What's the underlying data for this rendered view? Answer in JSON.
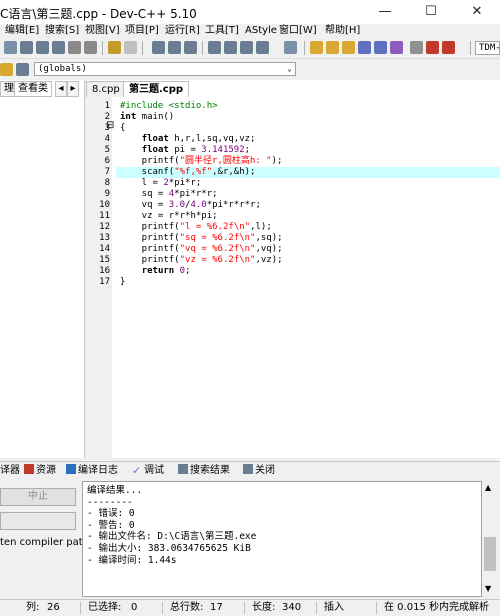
{
  "window": {
    "title": "C语言\\第三题.cpp - Dev-C++ 5.10",
    "minimize": "—",
    "maximize": "☐",
    "close": "✕"
  },
  "menu": [
    "编辑[E]",
    "搜索[S]",
    "视图[V]",
    "项目[P]",
    "运行[R]",
    "工具[T]",
    "AStyle",
    "窗口[W]",
    "帮助[H]"
  ],
  "toolbar": {
    "compiler_combo": "TDM-",
    "scope_combo": "(globals)"
  },
  "left_panel": {
    "tabs": [
      "理",
      "查看类"
    ]
  },
  "editor": {
    "tabs": [
      "8.cpp",
      "第三题.cpp"
    ],
    "active_tab": 1,
    "current_line": 7,
    "fold_marker": "⊟",
    "lines": [
      [
        [
          "pp",
          "#include <stdio.h>"
        ]
      ],
      [
        [
          "kw",
          "int"
        ],
        [
          "t",
          " main()"
        ]
      ],
      [
        [
          "t",
          "{"
        ]
      ],
      [
        [
          "t",
          "    "
        ],
        [
          "kw",
          "float"
        ],
        [
          "t",
          " h,r,l,sq,vq,vz;"
        ]
      ],
      [
        [
          "t",
          "    "
        ],
        [
          "kw",
          "float"
        ],
        [
          "t",
          " pi = "
        ],
        [
          "num",
          "3.141592"
        ],
        [
          "t",
          ";"
        ]
      ],
      [
        [
          "t",
          "    printf("
        ],
        [
          "str",
          "\"圆半径r,圆柱高h: \""
        ],
        [
          "t",
          ");"
        ]
      ],
      [
        [
          "t",
          "    scanf("
        ],
        [
          "str",
          "\"%f,%f\""
        ],
        [
          "t",
          ",&r,&h);"
        ]
      ],
      [
        [
          "t",
          "    l = "
        ],
        [
          "num",
          "2"
        ],
        [
          "t",
          "*pi*r;"
        ]
      ],
      [
        [
          "t",
          "    sq = "
        ],
        [
          "num",
          "4"
        ],
        [
          "t",
          "*pi*r*r;"
        ]
      ],
      [
        [
          "t",
          "    vq = "
        ],
        [
          "num",
          "3.0"
        ],
        [
          "t",
          "/"
        ],
        [
          "num",
          "4.0"
        ],
        [
          "t",
          "*pi*r*r*r;"
        ]
      ],
      [
        [
          "t",
          "    vz = r*r*h*pi;"
        ]
      ],
      [
        [
          "t",
          "    printf("
        ],
        [
          "str",
          "\"l = %6.2f\\n\""
        ],
        [
          "t",
          ",l);"
        ]
      ],
      [
        [
          "t",
          "    printf("
        ],
        [
          "str",
          "\"sq = %6.2f\\n\""
        ],
        [
          "t",
          ",sq);"
        ]
      ],
      [
        [
          "t",
          "    printf("
        ],
        [
          "str",
          "\"vq = %6.2f\\n\""
        ],
        [
          "t",
          ",vq);"
        ]
      ],
      [
        [
          "t",
          "    printf("
        ],
        [
          "str",
          "\"vz = %6.2f\\n\""
        ],
        [
          "t",
          ",vz);"
        ]
      ],
      [
        [
          "t",
          "    "
        ],
        [
          "kw",
          "return"
        ],
        [
          "t",
          " "
        ],
        [
          "num",
          "0"
        ],
        [
          "t",
          ";"
        ]
      ],
      [
        [
          "t",
          "}"
        ]
      ]
    ]
  },
  "bottom_tabs": [
    "译器",
    "资源",
    "编译日志",
    "调试",
    "搜索结果",
    "关闭"
  ],
  "bottom_left": {
    "stop_button": "中止",
    "checkbox_label": "ten compiler paths"
  },
  "compile_log": [
    "编译结果...",
    "--------",
    "- 错误: 0",
    "- 警告: 0",
    "- 输出文件名: D:\\C语言\\第三题.exe",
    "- 输出大小: 383.0634765625 KiB",
    "- 编译时间: 1.44s"
  ],
  "status": {
    "col_label": "列:",
    "col_value": "26",
    "selected_label": "已选择:",
    "selected_value": "0",
    "lines_label": "总行数:",
    "lines_value": "17",
    "length_label": "长度:",
    "length_value": "340",
    "mode": "插入",
    "parse_info": "在 0.015 秒内完成解析"
  }
}
